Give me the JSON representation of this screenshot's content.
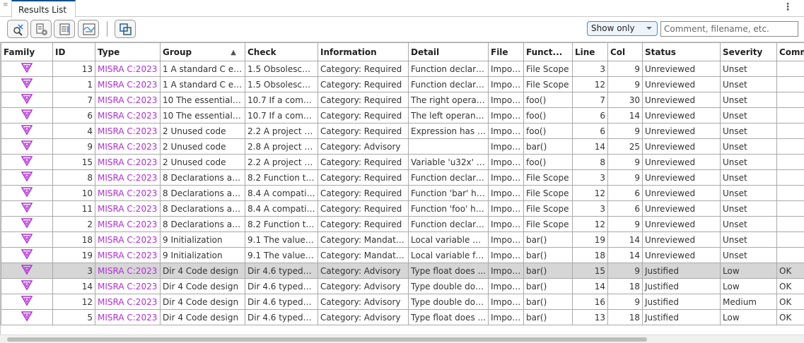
{
  "tab": {
    "title": "Results List"
  },
  "toolbar": {
    "buttons": [
      "filter-results-icon",
      "run-settings-icon",
      "report-icon",
      "chart-view-icon",
      "new-window-icon"
    ],
    "show_only": "Show only",
    "search_placeholder": "Comment, filename, etc."
  },
  "colors": {
    "type_link": "#b12fd6",
    "family_icon": "#b12fd6",
    "selected_row": "#d6d6d6",
    "tab_accent": "#0a4f8c"
  },
  "table": {
    "columns": [
      "Family",
      "ID",
      "Type",
      "Group",
      "Check",
      "Information",
      "Detail",
      "File",
      "Funct...",
      "Line",
      "Col",
      "Status",
      "Severity",
      "Comm"
    ],
    "sort": {
      "column": "Group",
      "direction": "ascending"
    },
    "selected_row_id": 3,
    "rows": [
      {
        "id": 13,
        "type": "MISRA C:2023",
        "group": "1 A standard C envi...",
        "check": "1.5 Obsolescent...",
        "info": "Category: Required",
        "detail": "Function declared...",
        "file": "Impor...",
        "func": "File Scope",
        "line": 3,
        "col": 9,
        "status": "Unreviewed",
        "severity": "Unset",
        "comment": ""
      },
      {
        "id": 1,
        "type": "MISRA C:2023",
        "group": "1 A standard C envi...",
        "check": "1.5 Obsolescent...",
        "info": "Category: Required",
        "detail": "Function declared...",
        "file": "Impor...",
        "func": "File Scope",
        "line": 12,
        "col": 9,
        "status": "Unreviewed",
        "severity": "Unset",
        "comment": ""
      },
      {
        "id": 7,
        "type": "MISRA C:2023",
        "group": "10 The essential ty...",
        "check": "10.7 If a compos...",
        "info": "Category: Required",
        "detail": "The right operand...",
        "file": "Impor...",
        "func": "foo()",
        "line": 7,
        "col": 30,
        "status": "Unreviewed",
        "severity": "Unset",
        "comment": ""
      },
      {
        "id": 6,
        "type": "MISRA C:2023",
        "group": "10 The essential ty...",
        "check": "10.7 If a compos...",
        "info": "Category: Required",
        "detail": "The left operand ...",
        "file": "Impor...",
        "func": "foo()",
        "line": 6,
        "col": 14,
        "status": "Unreviewed",
        "severity": "Unset",
        "comment": ""
      },
      {
        "id": 4,
        "type": "MISRA C:2023",
        "group": "2 Unused code",
        "check": "2.2 A project sh...",
        "info": "Category: Required",
        "detail": "Expression has no...",
        "file": "Impor...",
        "func": "foo()",
        "line": 6,
        "col": 9,
        "status": "Unreviewed",
        "severity": "Unset",
        "comment": ""
      },
      {
        "id": 9,
        "type": "MISRA C:2023",
        "group": "2 Unused code",
        "check": "2.8 A project sh...",
        "info": "Category: Advisory",
        "detail": "",
        "file": "Impor...",
        "func": "bar()",
        "line": 14,
        "col": 25,
        "status": "Unreviewed",
        "severity": "Unset",
        "comment": ""
      },
      {
        "id": 15,
        "type": "MISRA C:2023",
        "group": "2 Unused code",
        "check": "2.2 A project sh...",
        "info": "Category: Required",
        "detail": "Variable 'u32x' is ...",
        "file": "Impor...",
        "func": "foo()",
        "line": 8,
        "col": 9,
        "status": "Unreviewed",
        "severity": "Unset",
        "comment": ""
      },
      {
        "id": 8,
        "type": "MISRA C:2023",
        "group": "8 Declarations and ...",
        "check": "8.2 Function typ...",
        "info": "Category: Required",
        "detail": "Function declared...",
        "file": "Impor...",
        "func": "File Scope",
        "line": 3,
        "col": 9,
        "status": "Unreviewed",
        "severity": "Unset",
        "comment": ""
      },
      {
        "id": 10,
        "type": "MISRA C:2023",
        "group": "8 Declarations and ...",
        "check": "8.4 A compatibl...",
        "info": "Category: Required",
        "detail": "Function 'bar' has ...",
        "file": "Impor...",
        "func": "File Scope",
        "line": 12,
        "col": 6,
        "status": "Unreviewed",
        "severity": "Unset",
        "comment": ""
      },
      {
        "id": 11,
        "type": "MISRA C:2023",
        "group": "8 Declarations and ...",
        "check": "8.4 A compatibl...",
        "info": "Category: Required",
        "detail": "Function 'foo' has ...",
        "file": "Impor...",
        "func": "File Scope",
        "line": 3,
        "col": 6,
        "status": "Unreviewed",
        "severity": "Unset",
        "comment": ""
      },
      {
        "id": 2,
        "type": "MISRA C:2023",
        "group": "8 Declarations and ...",
        "check": "8.2 Function typ...",
        "info": "Category: Required",
        "detail": "Function declared...",
        "file": "Impor...",
        "func": "File Scope",
        "line": 12,
        "col": 9,
        "status": "Unreviewed",
        "severity": "Unset",
        "comment": ""
      },
      {
        "id": 18,
        "type": "MISRA C:2023",
        "group": "9 Initialization",
        "check": "9.1 The value of ...",
        "info": "Category: Mandatory",
        "detail": "Local variable d is ...",
        "file": "Impor...",
        "func": "bar()",
        "line": 19,
        "col": 14,
        "status": "Unreviewed",
        "severity": "Unset",
        "comment": ""
      },
      {
        "id": 19,
        "type": "MISRA C:2023",
        "group": "9 Initialization",
        "check": "9.1 The value of ...",
        "info": "Category: Mandatory",
        "detail": "Local variable f is ...",
        "file": "Impor...",
        "func": "bar()",
        "line": 18,
        "col": 14,
        "status": "Unreviewed",
        "severity": "Unset",
        "comment": ""
      },
      {
        "id": 3,
        "type": "MISRA C:2023",
        "group": "Dir 4 Code design",
        "check": "Dir 4.6 typedefs ...",
        "info": "Category: Advisory",
        "detail": "Type float does ...",
        "file": "Impor...",
        "func": "bar()",
        "line": 15,
        "col": 9,
        "status": "Justified",
        "severity": "Low",
        "comment": "OK"
      },
      {
        "id": 14,
        "type": "MISRA C:2023",
        "group": "Dir 4 Code design",
        "check": "Dir 4.6 typedefs ...",
        "info": "Category: Advisory",
        "detail": "Type double does...",
        "file": "Impor...",
        "func": "bar()",
        "line": 14,
        "col": 18,
        "status": "Justified",
        "severity": "Low",
        "comment": "OK"
      },
      {
        "id": 12,
        "type": "MISRA C:2023",
        "group": "Dir 4 Code design",
        "check": "Dir 4.6 typedefs ...",
        "info": "Category: Advisory",
        "detail": "Type double does...",
        "file": "Impor...",
        "func": "bar()",
        "line": 16,
        "col": 9,
        "status": "Justified",
        "severity": "Medium",
        "comment": "OK"
      },
      {
        "id": 5,
        "type": "MISRA C:2023",
        "group": "Dir 4 Code design",
        "check": "Dir 4.6 typedefs ...",
        "info": "Category: Advisory",
        "detail": "Type float does ...",
        "file": "Impor...",
        "func": "bar()",
        "line": 13,
        "col": 18,
        "status": "Justified",
        "severity": "Low",
        "comment": "OK"
      }
    ]
  }
}
